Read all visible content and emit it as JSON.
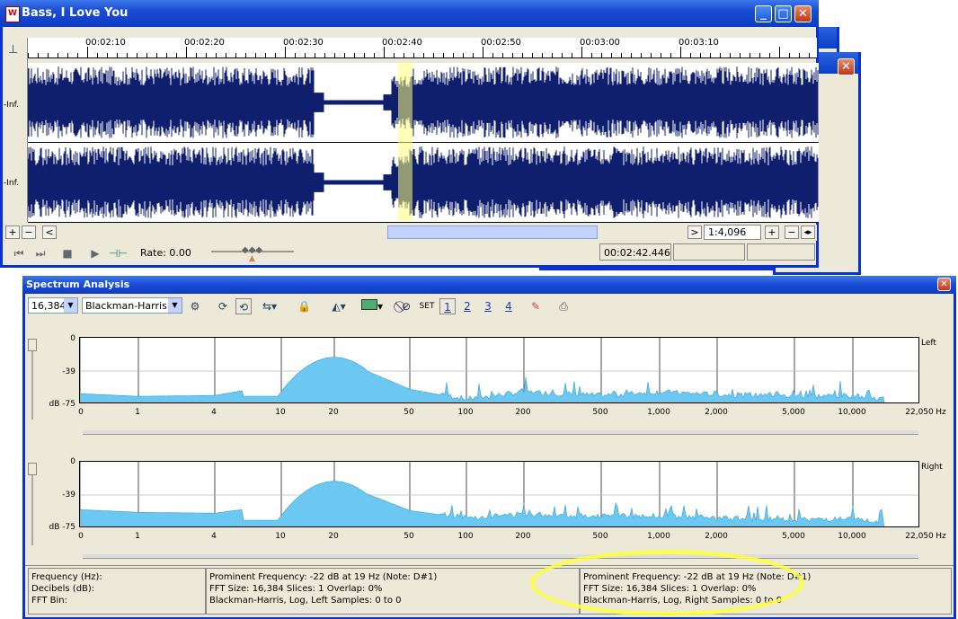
{
  "main_window": {
    "title": "Bass, I Love You",
    "ruler_labels": [
      "00:02:10",
      "00:02:20",
      "00:02:30",
      "00:02:40",
      "00:02:50",
      "00:03:00",
      "00:03:10"
    ],
    "channel_labels": [
      "-Inf.",
      "-Inf."
    ],
    "zoom": "1:4,096",
    "rate_label": "Rate: 0.00",
    "time": "00:02:42.446",
    "buttons": {
      "min": "_",
      "max": "□",
      "close": "✕",
      "plus": "+",
      "minus": "−",
      "left": "<",
      "right": ">"
    }
  },
  "spectrum": {
    "title": "Spectrum Analysis",
    "fft_size": "16,384",
    "window": "Blackman-Harris",
    "set_label": "SET",
    "channel_buttons": [
      "1",
      "2",
      "3",
      "4"
    ],
    "close": "✕",
    "db_labels": [
      "0",
      "-39",
      "dB -75"
    ],
    "freq_labels": [
      "0",
      "1",
      "4",
      "10",
      "20",
      "50",
      "100",
      "200",
      "500",
      "1,000",
      "2,000",
      "5,000",
      "10,000",
      "22,050"
    ],
    "hz": "Hz",
    "channels": [
      "Left",
      "Right"
    ],
    "status": {
      "col1": [
        "Frequency (Hz):",
        "Decibels (dB):",
        "FFT Bin:"
      ],
      "col2": [
        "Prominent Frequency: -22 dB at 19 Hz (Note: D#1)",
        "FFT Size: 16,384  Slices: 1  Overlap: 0%",
        "Blackman-Harris, Log, Left  Samples: 0 to 0"
      ],
      "col3": [
        "Prominent Frequency: -22 dB at 19 Hz (Note: D#1)",
        "FFT Size: 16,384  Slices: 1  Overlap: 0%",
        "Blackman-Harris, Log, Right  Samples: 0 to 0"
      ]
    }
  },
  "colors": {
    "title_blue": "#0c3cc4",
    "wave": "#0f1f6e",
    "spectrum": "#6cc8f0",
    "highlight": "#ffff60"
  },
  "chart_data": [
    {
      "type": "area",
      "channel": "Left",
      "x": [
        0,
        1,
        4,
        10,
        20,
        50,
        100,
        200,
        500,
        1000,
        2000,
        5000,
        10000,
        22050
      ],
      "y": [
        -63,
        -66,
        -65,
        -52,
        -22,
        -58,
        -70,
        -62,
        -66,
        -62,
        -65,
        -67,
        -66,
        -75
      ],
      "ylim": [
        -75,
        0
      ],
      "yticks": [
        "0",
        "-39",
        "dB -75"
      ],
      "xscale": "log"
    },
    {
      "type": "area",
      "channel": "Right",
      "x": [
        0,
        1,
        4,
        10,
        20,
        50,
        100,
        200,
        500,
        1000,
        2000,
        5000,
        10000,
        22050
      ],
      "y": [
        -54,
        -57,
        -58,
        -48,
        -22,
        -55,
        -64,
        -60,
        -62,
        -62,
        -65,
        -66,
        -66,
        -75
      ],
      "ylim": [
        -75,
        0
      ],
      "yticks": [
        "0",
        "-39",
        "dB -75"
      ],
      "xscale": "log"
    }
  ]
}
